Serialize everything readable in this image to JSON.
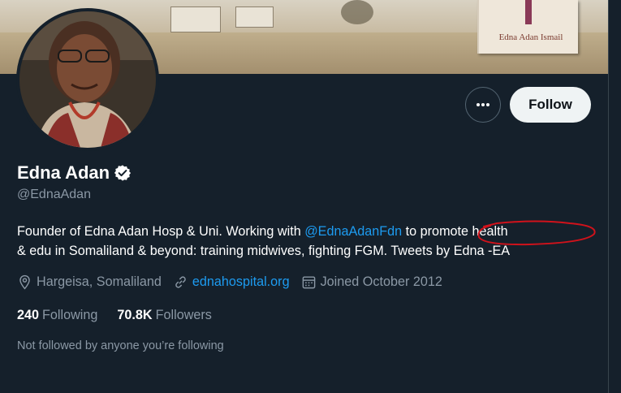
{
  "banner": {
    "book_author": "Edna Adan Ismail"
  },
  "profile": {
    "name": "Edna Adan",
    "handle": "@EdnaAdan",
    "verified": true,
    "bio": {
      "part1": "Founder of Edna Adan Hosp & Uni. Working with ",
      "mention": "@EdnaAdanFdn",
      "part2": " to promote health",
      "line2": "& edu in Somaliland & beyond: training midwives, fighting FGM. Tweets by Edna -EA"
    },
    "location": "Hargeisa, Somaliland",
    "website": "ednahospital.org",
    "joined": "Joined October 2012",
    "following_count": "240",
    "following_label": "Following",
    "followers_count": "70.8K",
    "followers_label": "Followers",
    "not_followed_text": "Not followed by anyone you’re following"
  },
  "actions": {
    "more_icon": "more-horizontal-icon",
    "follow_label": "Follow"
  },
  "colors": {
    "background": "#15202b",
    "accent": "#1d9bf0",
    "muted": "#8b98a5",
    "annotation": "#d0121b"
  }
}
